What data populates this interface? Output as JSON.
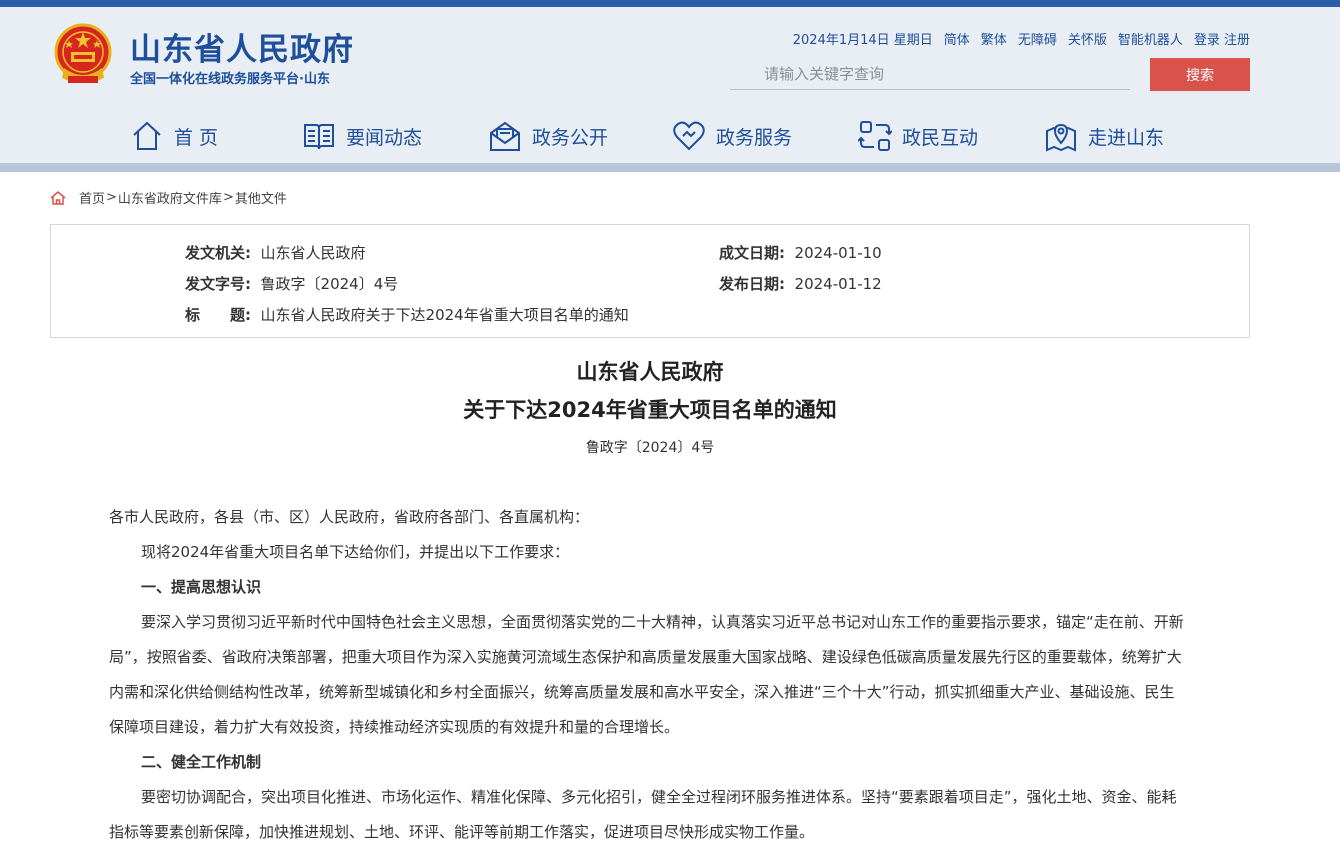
{
  "header": {
    "title": "山东省人民政府",
    "subtitle": "全国一体化在线政务服务平台·山东",
    "date": "2024年1月14日 星期日",
    "links": [
      "简体",
      "繁体",
      "无障碍",
      "关怀版",
      "智能机器人",
      "登录 注册"
    ],
    "search_placeholder": "请输入关键字查询",
    "search_button": "搜索"
  },
  "nav": [
    {
      "label": "首 页",
      "icon": "home-icon"
    },
    {
      "label": "要闻动态",
      "icon": "book-icon"
    },
    {
      "label": "政务公开",
      "icon": "mail-icon"
    },
    {
      "label": "政务服务",
      "icon": "heart-icon"
    },
    {
      "label": "政民互动",
      "icon": "exchange-icon"
    },
    {
      "label": "走进山东",
      "icon": "map-pin-icon"
    }
  ],
  "breadcrumb": [
    "首页",
    "山东省政府文件库",
    "其他文件"
  ],
  "meta": {
    "issuer_label": "发文机关:",
    "issuer": "山东省人民政府",
    "created_label": "成文日期:",
    "created": "2024-01-10",
    "doc_no_label": "发文字号:",
    "doc_no": "鲁政字〔2024〕4号",
    "published_label": "发布日期:",
    "published": "2024-01-12",
    "subject_label": "标　　题:",
    "subject": "山东省人民政府关于下达2024年省重大项目名单的通知"
  },
  "document": {
    "title_line1": "山东省人民政府",
    "title_line2": "关于下达2024年省重大项目名单的通知",
    "doc_no": "鲁政字〔2024〕4号",
    "salutation": "各市人民政府，各县（市、区）人民政府，省政府各部门、各直属机构：",
    "intro": "现将2024年省重大项目名单下达给你们，并提出以下工作要求：",
    "section1_title": "一、提高思想认识",
    "section1_body": "要深入学习贯彻习近平新时代中国特色社会主义思想，全面贯彻落实党的二十大精神，认真落实习近平总书记对山东工作的重要指示要求，锚定“走在前、开新局”，按照省委、省政府决策部署，把重大项目作为深入实施黄河流域生态保护和高质量发展重大国家战略、建设绿色低碳高质量发展先行区的重要载体，统筹扩大内需和深化供给侧结构性改革，统筹新型城镇化和乡村全面振兴，统筹高质量发展和高水平安全，深入推进“三个十大”行动，抓实抓细重大产业、基础设施、民生保障项目建设，着力扩大有效投资，持续推动经济实现质的有效提升和量的合理增长。",
    "section2_title": "二、健全工作机制",
    "section2_body": "要密切协调配合，突出项目化推进、市场化运作、精准化保障、多元化招引，健全全过程闭环服务推进体系。坚持“要素跟着项目走”，强化土地、资金、能耗指标等要素创新保障，加快推进规划、土地、环评、能评等前期工作落实，促进项目尽快形成实物工作量。"
  },
  "colors": {
    "brand": "#1d4f9a",
    "topbar": "#2a5ea8",
    "header_bg": "#e9eef5",
    "search_button": "#d9534a"
  }
}
